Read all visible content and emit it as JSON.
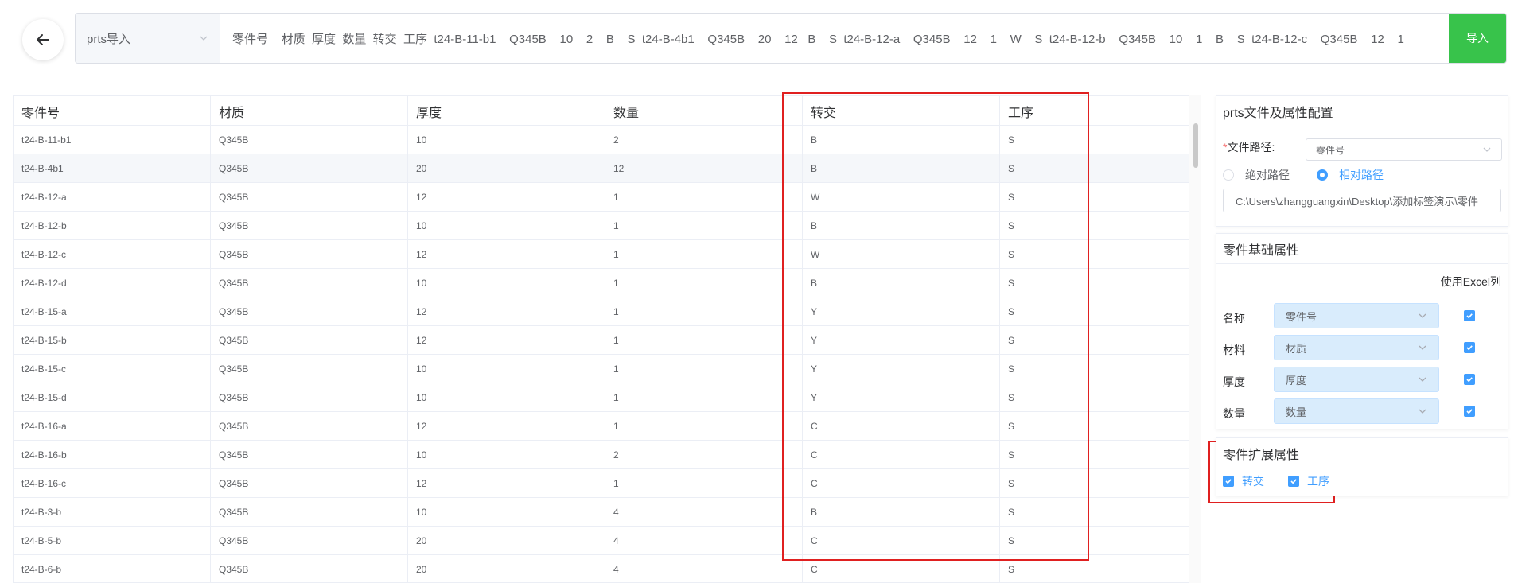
{
  "topbar": {
    "select_value": "prts导入",
    "input_text": "零件号    材质  厚度  数量  转交  工序  t24-B-11-b1    Q345B    10    2    B    S  t24-B-4b1    Q345B    20    12   B    S  t24-B-12-a    Q345B    12    1    W    S  t24-B-12-b    Q345B    10    1    B    S  t24-B-12-c    Q345B    12    1",
    "import_label": "导入"
  },
  "table": {
    "headers": [
      "零件号",
      "材质",
      "厚度",
      "数量",
      "转交",
      "工序"
    ],
    "rows": [
      [
        "t24-B-11-b1",
        "Q345B",
        "10",
        "2",
        "B",
        "S"
      ],
      [
        "t24-B-4b1",
        "Q345B",
        "20",
        "12",
        "B",
        "S"
      ],
      [
        "t24-B-12-a",
        "Q345B",
        "12",
        "1",
        "W",
        "S"
      ],
      [
        "t24-B-12-b",
        "Q345B",
        "10",
        "1",
        "B",
        "S"
      ],
      [
        "t24-B-12-c",
        "Q345B",
        "12",
        "1",
        "W",
        "S"
      ],
      [
        "t24-B-12-d",
        "Q345B",
        "10",
        "1",
        "B",
        "S"
      ],
      [
        "t24-B-15-a",
        "Q345B",
        "12",
        "1",
        "Y",
        "S"
      ],
      [
        "t24-B-15-b",
        "Q345B",
        "12",
        "1",
        "Y",
        "S"
      ],
      [
        "t24-B-15-c",
        "Q345B",
        "10",
        "1",
        "Y",
        "S"
      ],
      [
        "t24-B-15-d",
        "Q345B",
        "10",
        "1",
        "Y",
        "S"
      ],
      [
        "t24-B-16-a",
        "Q345B",
        "12",
        "1",
        "C",
        "S"
      ],
      [
        "t24-B-16-b",
        "Q345B",
        "10",
        "2",
        "C",
        "S"
      ],
      [
        "t24-B-16-c",
        "Q345B",
        "12",
        "1",
        "C",
        "S"
      ],
      [
        "t24-B-3-b",
        "Q345B",
        "10",
        "4",
        "B",
        "S"
      ],
      [
        "t24-B-5-b",
        "Q345B",
        "20",
        "4",
        "C",
        "S"
      ],
      [
        "t24-B-6-b",
        "Q345B",
        "20",
        "4",
        "C",
        "S"
      ]
    ]
  },
  "config_panel": {
    "title": "prts文件及属性配置",
    "path_label": "*文件路径:",
    "path_label_text": "文件路径:",
    "path_select": "零件号",
    "radio_absolute": "绝对路径",
    "radio_relative": "相对路径",
    "path_value": "C:\\Users\\zhangguangxin\\Desktop\\添加标签演示\\零件"
  },
  "basic_panel": {
    "title": "零件基础属性",
    "excel_col_label": "使用Excel列",
    "rows": [
      {
        "label": "名称",
        "value": "零件号"
      },
      {
        "label": "材料",
        "value": "材质"
      },
      {
        "label": "厚度",
        "value": "厚度"
      },
      {
        "label": "数量",
        "value": "数量"
      }
    ]
  },
  "ext_panel": {
    "title": "零件扩展属性",
    "checks": [
      "转交",
      "工序"
    ]
  },
  "colors": {
    "accent": "#409eff",
    "import_green": "#38c34b",
    "highlight_red": "#e02020"
  }
}
